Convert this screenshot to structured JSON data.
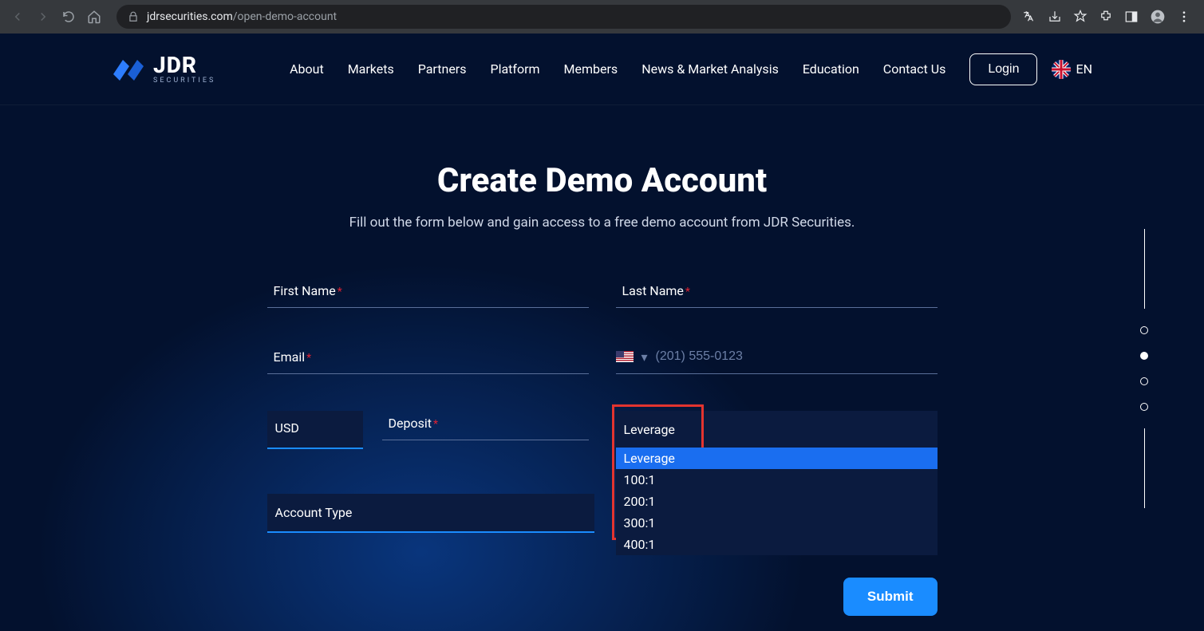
{
  "browser": {
    "url_domain": "jdrsecurities.com",
    "url_path": "/open-demo-account"
  },
  "header": {
    "logo_title": "JDR",
    "logo_sub": "SECURITIES",
    "nav": [
      "About",
      "Markets",
      "Partners",
      "Platform",
      "Members",
      "News & Market Analysis",
      "Education",
      "Contact Us"
    ],
    "login": "Login",
    "lang": "EN"
  },
  "page": {
    "title": "Create Demo Account",
    "subtitle": "Fill out the form below and gain access to a free demo account from JDR Securities."
  },
  "form": {
    "first_name_label": "First Name",
    "last_name_label": "Last Name",
    "email_label": "Email",
    "phone_placeholder": "(201) 555-0123",
    "currency": "USD",
    "deposit_label": "Deposit",
    "leverage_label": "Leverage",
    "leverage_options": [
      "Leverage",
      "100:1",
      "200:1",
      "300:1",
      "400:1"
    ],
    "account_type_label": "Account Type",
    "submit": "Submit"
  }
}
